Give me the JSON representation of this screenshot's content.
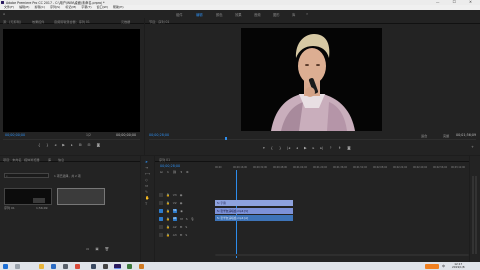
{
  "app": {
    "title": "Adobe Premiere Pro CC 2017 - C:\\用户\\WIN\\桌面\\未命名.prproj *",
    "window_controls": [
      "—",
      "☐",
      "✕"
    ]
  },
  "menu": [
    "文件(F)",
    "编辑(E)",
    "剪辑(C)",
    "序列(S)",
    "标记(M)",
    "字幕(T)",
    "窗口(W)",
    "帮助(H)"
  ],
  "workspaces": {
    "tabs": [
      "组件",
      "编辑",
      "颜色",
      "效果",
      "音频",
      "图形",
      "库"
    ],
    "active_index": 1
  },
  "source_monitor": {
    "tabs": [
      "源：(无剪辑)",
      "效果控件",
      "音频剪辑混合器：序列 01",
      "元数据"
    ],
    "timecode_in": "00;00;00;00",
    "timecode_out": "00;00;00;00",
    "page_label": "1/2"
  },
  "program_monitor": {
    "tab": "节目：序列 01",
    "timecode_in": "00;00;28;00",
    "fit_label": "适合",
    "quality_label": "完整",
    "timecode_out": "00;01;56;09"
  },
  "project_panel": {
    "tabs": [
      "项目：未命名",
      "媒体浏览器",
      "库",
      "信息"
    ],
    "search_placeholder": "",
    "count_label": "1 项已选择，共 2 项",
    "item_name": "序列 01",
    "item_duration": "1;56;09"
  },
  "timeline": {
    "tab": "序列 01",
    "timecode": "00;00;28;00",
    "ruler_labels": [
      "00;00",
      "00;00;16;00",
      "00;00;32;00",
      "00;00;48;00",
      "00;01;04;02",
      "00;01;20;02",
      "00;01;36;02",
      "00;01;52;02",
      "00;02;08;04",
      "00;02;24;04",
      "00;02;40;04",
      "00;02;56;04",
      "00;03;12;06"
    ],
    "tracks": [
      {
        "name": "V3"
      },
      {
        "name": "V2"
      },
      {
        "name": "V1"
      },
      {
        "name": "A1"
      },
      {
        "name": "A2"
      },
      {
        "name": "A3"
      }
    ],
    "clips": {
      "v2_label": "fx 字幕",
      "v1_label": "fx 张学友演唱会.mp4 [V]",
      "a1_label": "fx 张学友演唱会.mp4 [A]"
    }
  },
  "taskbar": {
    "time": "12:17",
    "date": "2019/1/8",
    "lang": "中"
  },
  "colors": {
    "accent": "#2d8ceb",
    "clip_blue": "#8ca0e6",
    "clip_audio": "#3e74b8"
  }
}
